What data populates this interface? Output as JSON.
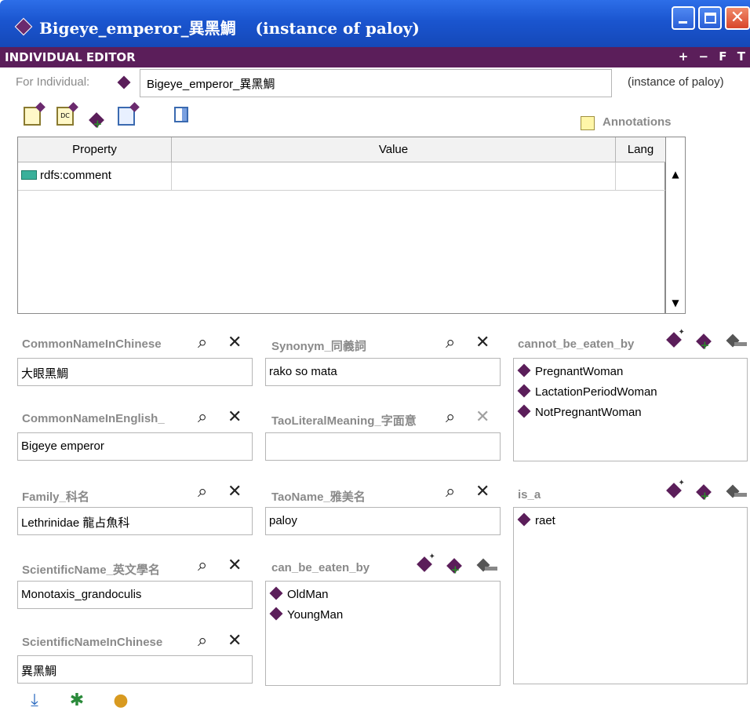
{
  "window": {
    "title": "Bigeye_emperor_異黑鯛",
    "title_suffix": "(instance of paloy)",
    "controls": [
      "minimize-icon",
      "maximize-icon",
      "close-icon"
    ]
  },
  "editor": {
    "header": "INDIVIDUAL EDITOR",
    "header_actions": "+ − F T"
  },
  "for_individual": {
    "label": "For Individual:",
    "value": "Bigeye_emperor_異黑鯛",
    "instance_of": "(instance of paloy)"
  },
  "toolbar": {
    "icons": [
      "create-property-icon",
      "create-datatype-icon",
      "add-value-icon",
      "delete-value-icon",
      "column-toggle-icon"
    ],
    "annotations_label": "Annotations"
  },
  "table": {
    "headers": [
      "Property",
      "Value",
      "Lang"
    ],
    "rows": [
      {
        "property": "rdfs:comment",
        "value": "",
        "lang": ""
      }
    ]
  },
  "fields": {
    "common_name_chinese": {
      "label": "CommonNameInChinese",
      "value": "大眼黑鯛"
    },
    "common_name_english": {
      "label": "CommonNameInEnglish_",
      "value": "Bigeye emperor"
    },
    "family": {
      "label": "Family_科名",
      "value": "Lethrinidae 龍占魚科"
    },
    "scientific_name": {
      "label": "ScientificName_英文學名",
      "value": "Monotaxis_grandoculis"
    },
    "scientific_name_chinese": {
      "label": "ScientificNameInChinese",
      "value": "異黑鯛"
    },
    "synonym": {
      "label": "Synonym_同義詞",
      "value": "rako so mata"
    },
    "tao_literal": {
      "label": "TaoLiteralMeaning_字面意",
      "value": ""
    },
    "tao_name": {
      "label": "TaoName_雅美名",
      "value": "paloy"
    }
  },
  "lists": {
    "can_be_eaten_by": {
      "label": "can_be_eaten_by",
      "items": [
        "OldMan",
        "YoungMan"
      ]
    },
    "cannot_be_eaten_by": {
      "label": "cannot_be_eaten_by",
      "items": [
        "PregnantWoman",
        "LactationPeriodWoman",
        "NotPregnantWoman"
      ]
    },
    "is_a": {
      "label": "is_a",
      "items": [
        "raet"
      ]
    }
  },
  "bottom_toolbar": {
    "icons": [
      "download-icon",
      "bug-icon",
      "create-instance-icon"
    ]
  },
  "colors": {
    "titlebar": "#1a55cf",
    "header": "#5b1e5a",
    "diamond": "#5b1e5a"
  }
}
